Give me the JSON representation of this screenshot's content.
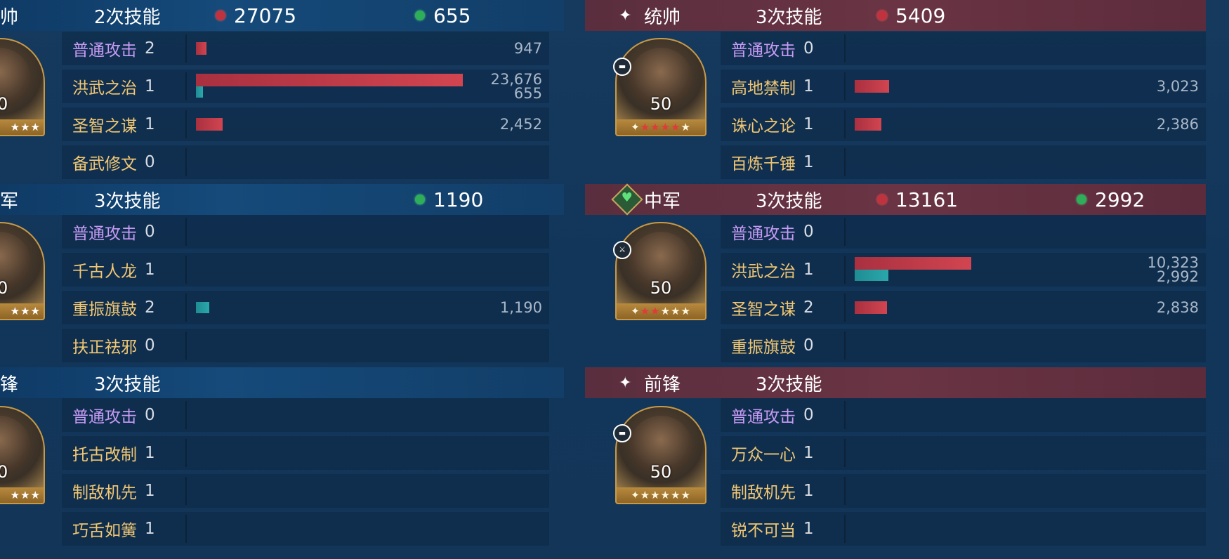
{
  "left": {
    "groups": [
      {
        "role": "帅",
        "skill_count": "2次技能",
        "damage": "27075",
        "heal": "655",
        "portrait": {
          "level": "0",
          "stars": "★★★"
        },
        "skills": [
          {
            "name": "普通攻击",
            "count": "2",
            "value": "947",
            "type": "basic"
          },
          {
            "name": "洪武之治",
            "count": "1",
            "value": "23,676",
            "value2": "655"
          },
          {
            "name": "圣智之谋",
            "count": "1",
            "value": "2,452"
          },
          {
            "name": "备武修文",
            "count": "0",
            "value": ""
          }
        ]
      },
      {
        "role": "军",
        "skill_count": "3次技能",
        "damage": "",
        "heal": "1190",
        "portrait": {
          "level": "0",
          "stars": "★★★"
        },
        "skills": [
          {
            "name": "普通攻击",
            "count": "0",
            "value": "",
            "type": "basic"
          },
          {
            "name": "千古人龙",
            "count": "1",
            "value": ""
          },
          {
            "name": "重振旗鼓",
            "count": "2",
            "value": "1,190"
          },
          {
            "name": "扶正祛邪",
            "count": "0",
            "value": ""
          }
        ]
      },
      {
        "role": "锋",
        "skill_count": "3次技能",
        "damage": "",
        "heal": "",
        "portrait": {
          "level": "0",
          "stars": "★★★"
        },
        "skills": [
          {
            "name": "普通攻击",
            "count": "0",
            "value": "",
            "type": "basic"
          },
          {
            "name": "托古改制",
            "count": "1",
            "value": ""
          },
          {
            "name": "制敌机先",
            "count": "1",
            "value": ""
          },
          {
            "name": "巧舌如簧",
            "count": "1",
            "value": ""
          }
        ]
      }
    ]
  },
  "right": {
    "groups": [
      {
        "role": "统帅",
        "skill_count": "3次技能",
        "damage": "5409",
        "heal": "",
        "portrait": {
          "level": "50",
          "stars_white": "✦",
          "stars_red": "★★★★",
          "stars_tail": "★"
        },
        "skills": [
          {
            "name": "普通攻击",
            "count": "0",
            "value": "",
            "type": "basic"
          },
          {
            "name": "高地禁制",
            "count": "1",
            "value": "3,023"
          },
          {
            "name": "诛心之论",
            "count": "1",
            "value": "2,386"
          },
          {
            "name": "百炼千锤",
            "count": "1",
            "value": ""
          }
        ]
      },
      {
        "role": "中军",
        "skill_count": "3次技能",
        "damage": "13161",
        "heal": "2992",
        "portrait": {
          "level": "50",
          "stars_white": "✦",
          "stars_red": "★★",
          "stars_tail": "★★★"
        },
        "skills": [
          {
            "name": "普通攻击",
            "count": "0",
            "value": "",
            "type": "basic"
          },
          {
            "name": "洪武之治",
            "count": "1",
            "value": "10,323",
            "value2": "2,992"
          },
          {
            "name": "圣智之谋",
            "count": "2",
            "value": "2,838"
          },
          {
            "name": "重振旗鼓",
            "count": "0",
            "value": ""
          }
        ]
      },
      {
        "role": "前锋",
        "skill_count": "3次技能",
        "damage": "",
        "heal": "",
        "portrait": {
          "level": "50",
          "stars_white": "✦",
          "stars_red": "",
          "stars_tail": "★★★★★"
        },
        "skills": [
          {
            "name": "普通攻击",
            "count": "0",
            "value": "",
            "type": "basic"
          },
          {
            "name": "万众一心",
            "count": "1",
            "value": ""
          },
          {
            "name": "制敌机先",
            "count": "1",
            "value": ""
          },
          {
            "name": "锐不可当",
            "count": "1",
            "value": ""
          }
        ]
      }
    ]
  },
  "bar_fractions": {
    "left": [
      [
        0.04,
        1.0,
        0.1,
        0
      ],
      [
        0,
        0,
        0.05,
        0
      ],
      [
        0,
        0,
        0,
        0
      ]
    ],
    "left_heal": [
      [
        0,
        0.025,
        0,
        0
      ],
      [
        0,
        0,
        0,
        0
      ],
      [
        0,
        0,
        0,
        0
      ]
    ],
    "right": [
      [
        0,
        0.128,
        0.101,
        0
      ],
      [
        0,
        0.436,
        0.12,
        0
      ],
      [
        0,
        0,
        0,
        0
      ]
    ],
    "right_heal": [
      [
        0,
        0,
        0,
        0
      ],
      [
        0,
        0.126,
        0,
        0
      ],
      [
        0,
        0,
        0,
        0
      ]
    ]
  }
}
